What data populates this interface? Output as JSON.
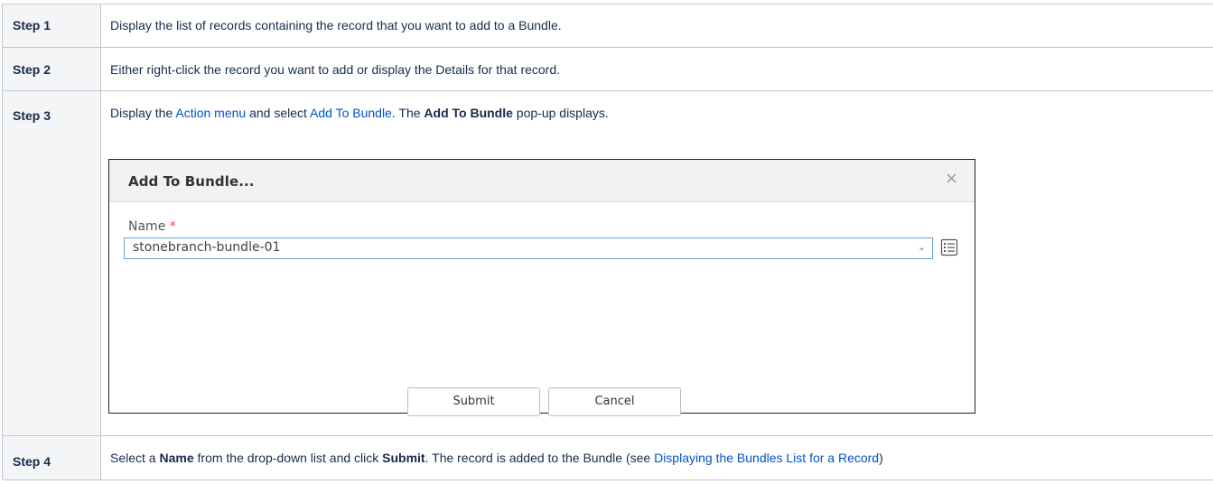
{
  "steps": [
    {
      "label": "Step 1",
      "text": "Display the list of records containing the record that you want to add to a Bundle."
    },
    {
      "label": "Step 2",
      "text": "Either right-click the record you want to add or display the Details for that record."
    },
    {
      "label": "Step 3",
      "text_a": "Display the ",
      "link_a": "Action menu",
      "text_b": " and select ",
      "link_b": "Add To Bundle",
      "text_c": ". The ",
      "bold_a": "Add To Bundle",
      "text_d": " pop-up displays."
    },
    {
      "label": "Step 4",
      "text_a": "Select a ",
      "bold_a": "Name",
      "text_b": " from the drop-down list and click ",
      "bold_b": "Submit",
      "text_c": ". The record is added to the Bundle (see ",
      "link_a": "Displaying the Bundles List for a Record",
      "text_d": ")"
    }
  ],
  "dialog": {
    "title": "Add To Bundle...",
    "close_glyph": "×",
    "name_label": "Name",
    "required_marker": "*",
    "name_value": "stonebranch-bundle-01",
    "caret_glyph": "⌄",
    "submit_label": "Submit",
    "cancel_label": "Cancel"
  },
  "colors": {
    "link": "#0052cc",
    "header_bg": "#f4f5f7",
    "border": "#c1c7d0",
    "required": "#e0533c",
    "select_border": "#6a9ed4"
  }
}
